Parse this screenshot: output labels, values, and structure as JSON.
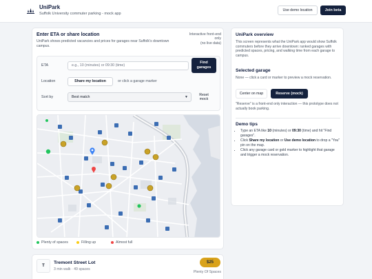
{
  "header": {
    "brand": "UniPark",
    "tagline": "Suffolk University commuter parking - mock app",
    "demo_location_label": "Use demo location",
    "join_beta_label": "Join beta"
  },
  "search": {
    "title": "Enter ETA or share location",
    "subtitle": "UniPark shows predicted vacancies and prices for garages near Suffolk's downtown campus.",
    "note_line1": "Interactive front-end",
    "note_line2": "only",
    "note_line3": "(no live data)",
    "eta_label": "ETA",
    "eta_placeholder": "e.g., 10 (minutes) or 09:30 (time)",
    "find_line1": "Find",
    "find_line2": "garages",
    "location_label": "Location",
    "share_location_label": "Share my location",
    "or_marker_text": "or click a garage marker",
    "sort_label": "Sort by",
    "sort_value": "Best match",
    "reset_line1": "Reset",
    "reset_line2": "mock"
  },
  "map": {
    "legend": [
      {
        "label": "Plenty of spaces",
        "color": "#22c55e"
      },
      {
        "label": "Filling up",
        "color": "#facc15"
      },
      {
        "label": "Almost full",
        "color": "#ef4444"
      }
    ]
  },
  "overview": {
    "title": "UniPark overview",
    "body": "This screen represents what the UniPark app would show Suffolk commuters before they arrive downtown: ranked garages with predicted spaces, pricing, and walking time from each garage to campus.",
    "selected_title": "Selected garage",
    "selected_body": "None — click a card or marker to preview a mock reservation.",
    "center_map_label": "Center on map",
    "reserve_label": "Reserve (mock)",
    "reserve_note": "\"Reserve\" is a front-end only interaction — this prototype does not actually book parking.",
    "tips_title": "Demo tips",
    "tips": {
      "t1_a": "Type an ETA like ",
      "t1_b": "10",
      "t1_c": " (minutes) or ",
      "t1_d": "09:30",
      "t1_e": " (time) and hit \"Find garages\".",
      "t2_a": "Click ",
      "t2_b": "Share my location",
      "t2_c": " or ",
      "t2_d": "Use demo location",
      "t2_e": " to drop a \"You\" pin on the map.",
      "t3": "Click any garage card or gold marker to highlight that garage and trigger a mock reservation."
    }
  },
  "lot": {
    "initial": "T",
    "name": "Tremont Street Lot",
    "meta": "3 min walk · 49 spaces",
    "price": "$25",
    "status": "Plenty Of Spaces"
  },
  "colors": {
    "navy": "#14213d",
    "gold": "#d9a21a",
    "parking_blue": "#3b6db3"
  }
}
